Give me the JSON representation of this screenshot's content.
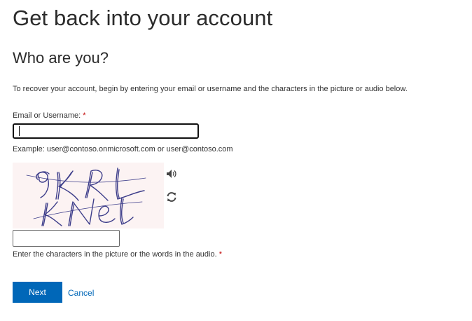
{
  "page": {
    "title": "Get back into your account",
    "section_title": "Who are you?",
    "intro": "To recover your account, begin by entering your email or username and the characters in the picture or audio below."
  },
  "email_field": {
    "label": "Email or Username:",
    "required_marker": "*",
    "value": "",
    "example": "Example: user@contoso.onmicrosoft.com or user@contoso.com"
  },
  "captcha": {
    "image_text": "9KRL KNel",
    "audio_icon": "speaker-icon",
    "refresh_icon": "refresh-icon",
    "input_value": "",
    "label": "Enter the characters in the picture or the words in the audio.",
    "required_marker": "*"
  },
  "actions": {
    "next_label": "Next",
    "cancel_label": "Cancel"
  },
  "colors": {
    "accent": "#0067b8",
    "required": "#c00000",
    "captcha_bg": "#fcf3f3",
    "captcha_ink": "#3d3d8a"
  }
}
